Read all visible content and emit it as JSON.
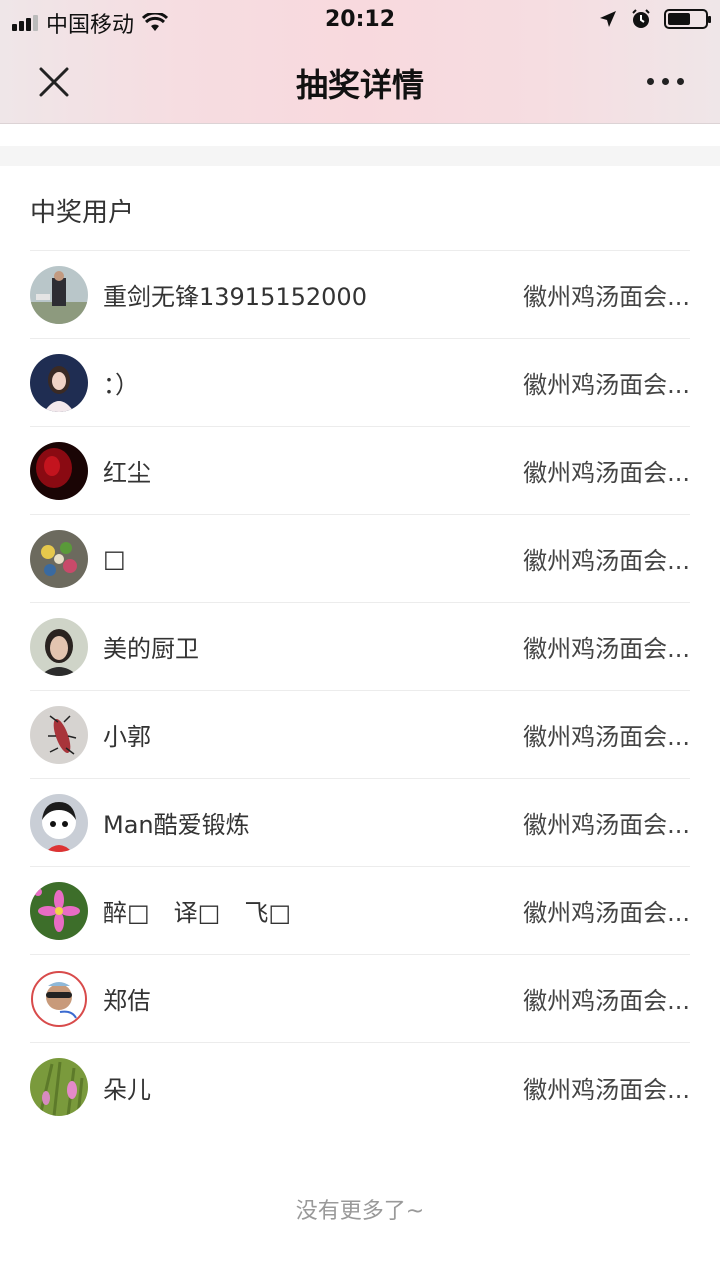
{
  "status_bar": {
    "carrier": "中国移动",
    "time": "20:12"
  },
  "header": {
    "title": "抽奖详情",
    "close_icon": "close-icon",
    "more_icon": "more-icon"
  },
  "section": {
    "title": "中奖用户"
  },
  "winners": [
    {
      "name": "重剑无锋13915152000",
      "shop": "徽州鸡汤面会..."
    },
    {
      "name": "：）",
      "shop": "徽州鸡汤面会..."
    },
    {
      "name": "红尘",
      "shop": "徽州鸡汤面会..."
    },
    {
      "name": "□",
      "shop": "徽州鸡汤面会..."
    },
    {
      "name": "美的厨卫",
      "shop": "徽州鸡汤面会..."
    },
    {
      "name": "小郭",
      "shop": "徽州鸡汤面会..."
    },
    {
      "name": "Man酷爱锻炼",
      "shop": "徽州鸡汤面会..."
    },
    {
      "name": "醉□　译□　飞□",
      "shop": "徽州鸡汤面会..."
    },
    {
      "name": "郑佶",
      "shop": "徽州鸡汤面会..."
    },
    {
      "name": "朵儿",
      "shop": "徽州鸡汤面会..."
    }
  ],
  "footer": {
    "text": "没有更多了~"
  }
}
